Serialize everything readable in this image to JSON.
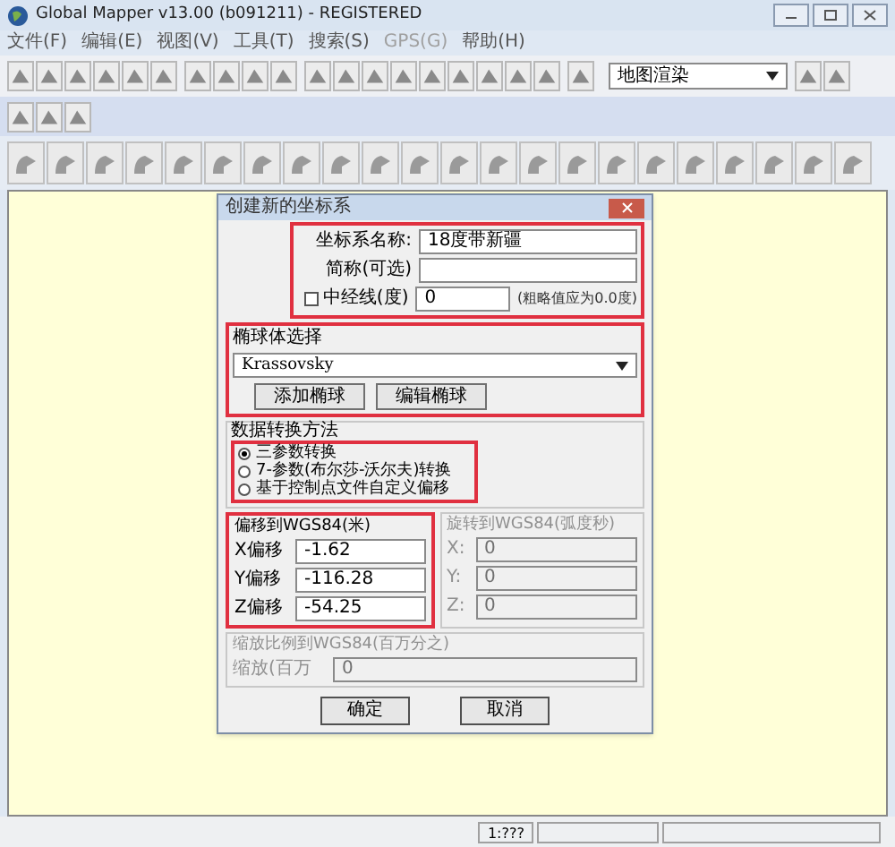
{
  "window": {
    "title": "Global Mapper v13.00 (b091211) - REGISTERED"
  },
  "menu": [
    "文件(F)",
    "编辑(E)",
    "视图(V)",
    "工具(T)",
    "搜索(S)",
    "GPS(G)",
    "帮助(H)"
  ],
  "toolbar": {
    "dropdown": "地图渲染"
  },
  "dialog": {
    "title": "创建新的坐标系",
    "fields": [
      {
        "label": "坐标系名称:",
        "value": "18度带新疆"
      },
      {
        "label": "简称(可选)"
      }
    ],
    "central_meridian": {
      "label": "中经线(度)",
      "checked": false,
      "value": "0",
      "note": "(粗略值应为0.0度)"
    },
    "ellipsoid": {
      "title": "椭球体选择",
      "value": "Krassovsky",
      "buttons": [
        "添加椭球",
        "编辑椭球"
      ]
    },
    "method": {
      "title": "数据转换方法",
      "options": [
        {
          "label": "三参数转换",
          "selected": true
        },
        {
          "label": "7-参数(布尔莎-沃尔夫)转换",
          "selected": false
        },
        {
          "label": "基于控制点文件自定义偏移",
          "selected": false
        }
      ]
    },
    "offset": {
      "title": "偏移到WGS84(米)",
      "disabled": false,
      "rows": [
        {
          "label": "X偏移",
          "value": "-1.62"
        },
        {
          "label": "Y偏移",
          "value": "-116.28"
        },
        {
          "label": "Z偏移",
          "value": "-54.25"
        }
      ]
    },
    "rotation": {
      "title": "旋转到WGS84(弧度秒)",
      "disabled": true,
      "rows": [
        {
          "label": "X:",
          "value": "0"
        },
        {
          "label": "Y:",
          "value": "0"
        },
        {
          "label": "Z:",
          "value": "0"
        }
      ]
    },
    "scale": {
      "title": "缩放比例到WGS84(百万分之)",
      "label": "缩放(百万",
      "value": "0",
      "disabled": true
    },
    "buttons": [
      "确定",
      "取消"
    ]
  },
  "status_bar": {
    "scale": "1:???"
  }
}
